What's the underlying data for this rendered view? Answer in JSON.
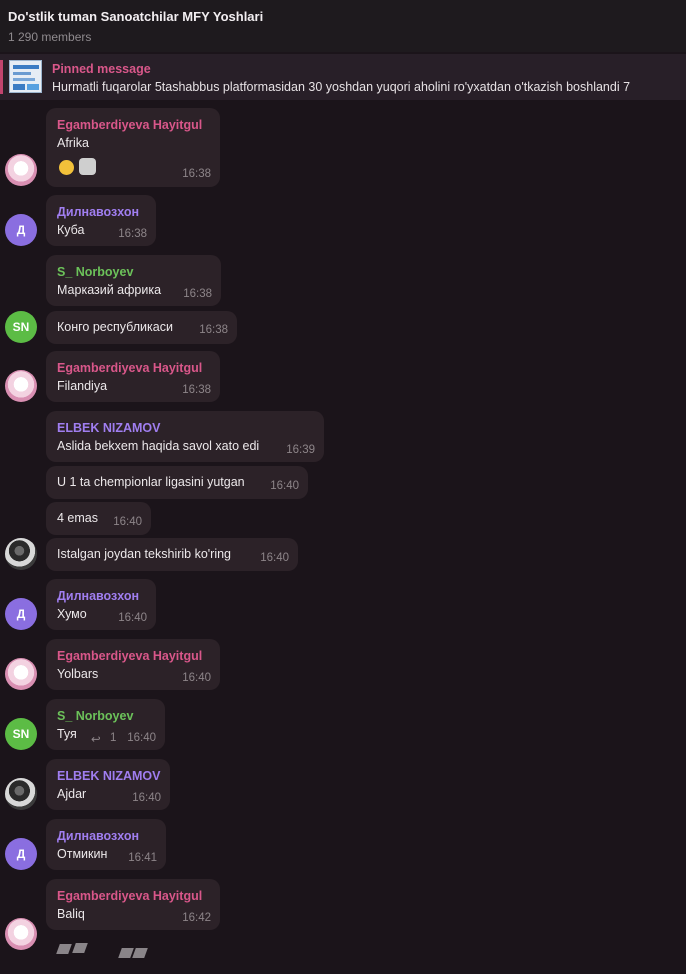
{
  "header": {
    "title": "Do'stlik tuman Sanoatchilar MFY Yoshlari",
    "members": "1 290 members"
  },
  "pinned": {
    "label": "Pinned message",
    "text": "Hurmatli fuqarolar  5tashabbus platformasidan 30 yoshdan yuqori aholini ro'yxatdan o'tkazish boshlandi 7"
  },
  "colors": {
    "pink": "#d9578a",
    "purple": "#a07ef0",
    "green": "#6cc25a",
    "bubble": "#2c2228"
  },
  "messages": [
    {
      "sender": "Egamberdiyeva Hayitgul",
      "text": "Afrika",
      "time": "16:38"
    },
    {
      "sender": "Дилнавозхон",
      "text": "Куба",
      "time": "16:38",
      "avatar_letter": "Д"
    },
    {
      "sender": "S_ Norboyev",
      "text": "Марказий африка",
      "time": "16:38"
    },
    {
      "text": "Конго республикаси",
      "time": "16:38",
      "avatar_letter": "SN"
    },
    {
      "sender": "Egamberdiyeva Hayitgul",
      "text": "Filandiya",
      "time": "16:38"
    },
    {
      "sender": "ELBEK NIZAMOV",
      "text": "Aslida bekxem haqida savol xato edi",
      "time": "16:39"
    },
    {
      "text": "U 1 ta chempionlar ligasini yutgan",
      "time": "16:40"
    },
    {
      "text": "4 emas",
      "time": "16:40"
    },
    {
      "text": "Istalgan joydan tekshirib ko'ring",
      "time": "16:40"
    },
    {
      "sender": "Дилнавозхон",
      "text": "Хумо",
      "time": "16:40",
      "avatar_letter": "Д"
    },
    {
      "sender": "Egamberdiyeva Hayitgul",
      "text": "Yolbars",
      "time": "16:40"
    },
    {
      "sender": "S_ Norboyev",
      "text": "Туя",
      "time": "16:40",
      "reply_count": "1",
      "avatar_letter": "SN"
    },
    {
      "sender": "ELBEK NIZAMOV",
      "text": "Ajdar",
      "time": "16:40"
    },
    {
      "sender": "Дилнавозхон",
      "text": "Отмикин",
      "time": "16:41",
      "avatar_letter": "Д"
    },
    {
      "sender": "Egamberdiyeva Hayitgul",
      "text": "Baliq",
      "time": "16:42"
    }
  ]
}
